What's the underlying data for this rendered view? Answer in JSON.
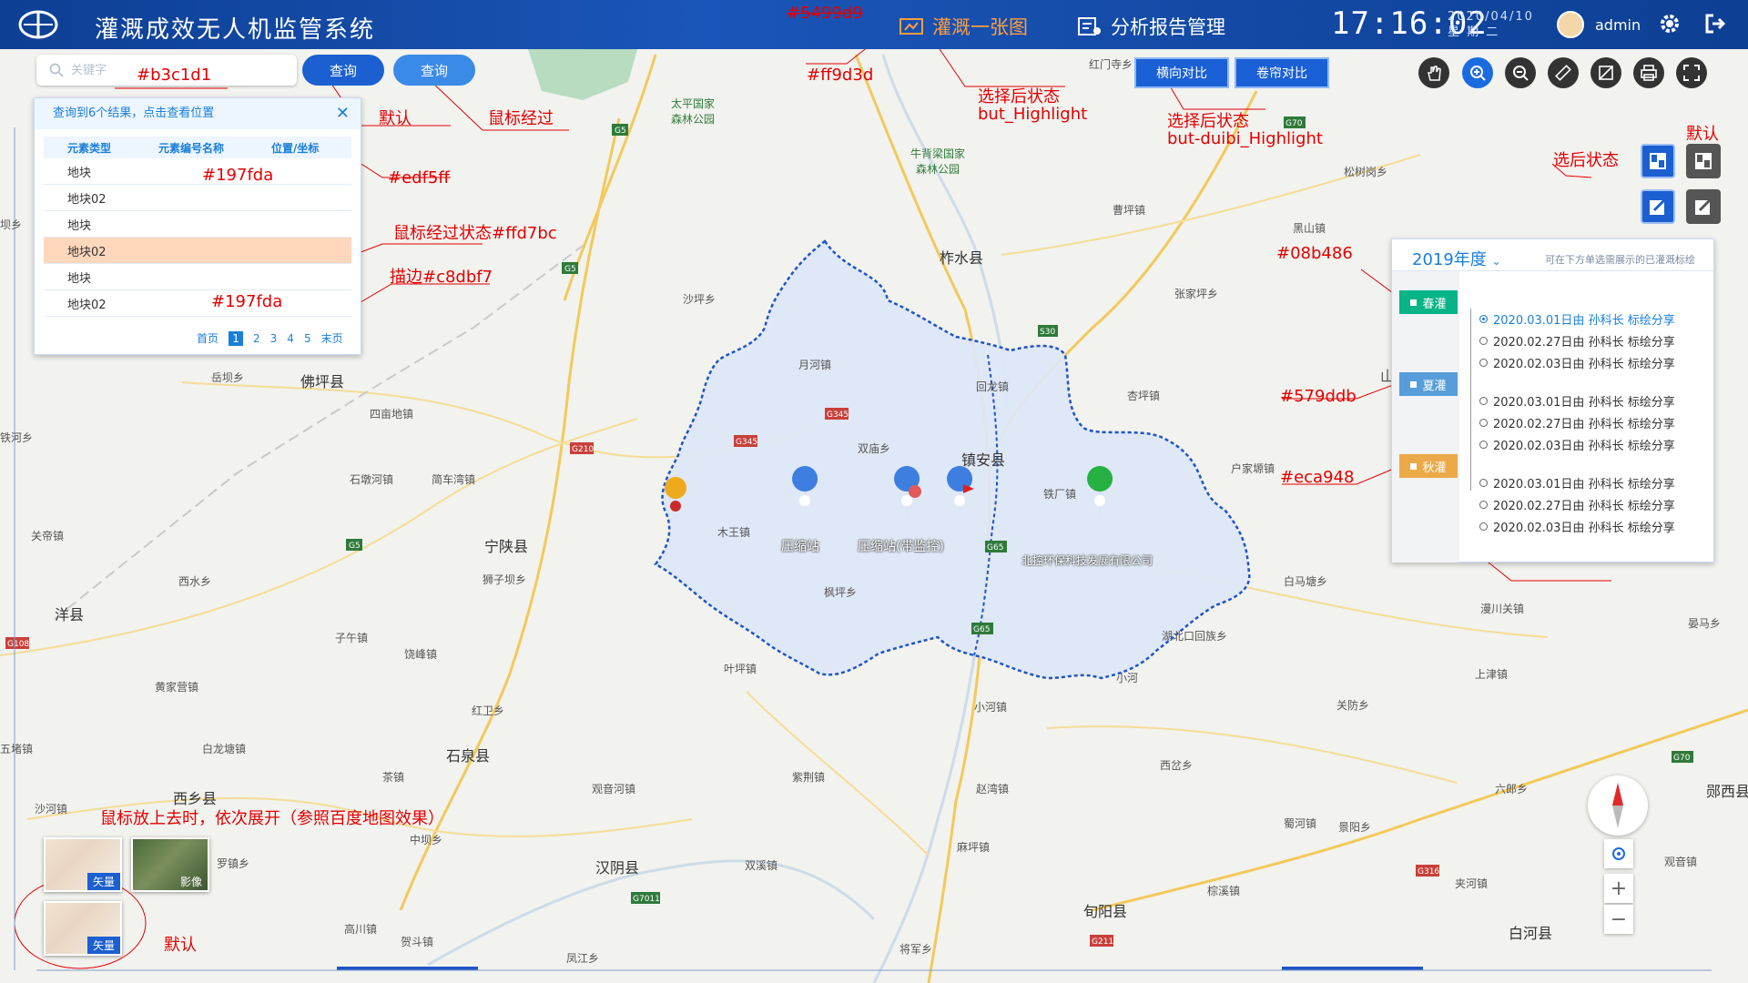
{
  "header": {
    "title": "灌溉成效无人机监管系统",
    "nav_items": [
      {
        "label": "灌溉一张图",
        "active": true
      },
      {
        "label": "分析报告管理",
        "active": false
      }
    ],
    "time": "17:16:02",
    "date_line1": "2020/04/10",
    "date_line2": "星 期 二",
    "username": "admin",
    "active_color": "#ff9d3d"
  },
  "search": {
    "placeholder": "关键字",
    "query_button_default": "查询",
    "query_button_hover": "查询"
  },
  "results": {
    "header": "查询到6个结果，点击查看位置",
    "columns": [
      "元素类型",
      "元素编号名称",
      "位置/坐标"
    ],
    "rows": [
      "地块",
      "地块02",
      "地块",
      "地块02",
      "地块",
      "地块02"
    ],
    "hover_row_index": 3,
    "pager": {
      "first": "首页",
      "pages": [
        "1",
        "2",
        "3",
        "4",
        "5"
      ],
      "current": "1",
      "last": "末页"
    }
  },
  "compare": {
    "horizontal": "横向对比",
    "curtain": "卷帘对比"
  },
  "tools": [
    "hand-icon",
    "zoom-in-icon",
    "zoom-out-icon",
    "ruler-icon",
    "area-measure-icon",
    "print-icon",
    "fullscreen-icon"
  ],
  "season_panel": {
    "year": "2019年度",
    "tip": "可在下方单选需展示的已灌溉标绘",
    "seasons": [
      {
        "name": "春灌",
        "color": "#08b486",
        "items": [
          "2020.03.01日由 孙科长 标绘分享",
          "2020.02.27日由 孙科长 标绘分享",
          "2020.02.03日由 孙科长 标绘分享"
        ]
      },
      {
        "name": "夏灌",
        "color": "#579ddb",
        "items": [
          "2020.03.01日由 孙科长 标绘分享",
          "2020.02.27日由 孙科长 标绘分享",
          "2020.02.03日由 孙科长 标绘分享"
        ]
      },
      {
        "name": "秋灌",
        "color": "#eca948",
        "items": [
          "2020.03.01日由 孙科长 标绘分享",
          "2020.02.27日由 孙科长 标绘分享",
          "2020.02.03日由 孙科长 标绘分享"
        ]
      }
    ]
  },
  "annotations": {
    "a_b3c1d1": "#b3c1d1",
    "a_default": "默认",
    "a_hover": "鼠标经过",
    "a_197fda_1": "#197fda",
    "a_edf5ff": "#edf5ff",
    "a_hover_state": "鼠标经过状态#ffd7bc",
    "a_stroke": "描边#c8dbf7",
    "a_197fda_2": "#197fda",
    "a_5499d9": "#5499d9",
    "a_ff9d3d": "#ff9d3d",
    "a_selected": "选择后状态",
    "a_but_highlight": "but_Highlight",
    "a_selected2": "选择后状态",
    "a_duibi": "but-duibi_Highlight",
    "a_default_r": "默认",
    "a_selected_r": "选后状态",
    "a_08b486": "#08b486",
    "a_579ddb": "#579ddb",
    "a_eca948": "#eca948",
    "a_basemap_tip": "鼠标放上去时，依次展开（参照百度地图效果）",
    "a_default_bl": "默认"
  },
  "basemaps": {
    "vector": "矢量",
    "image": "影像",
    "vector_default": "矢量"
  },
  "map": {
    "pois": [
      {
        "label": "压缩站",
        "color": "#3d7ee0"
      },
      {
        "label": "压缩站(带监控)",
        "color": "#3d7ee0"
      },
      {
        "label": "北控环保科技发展有限公司",
        "color": "#27b043"
      }
    ],
    "towns": {
      "county1": "镇安县",
      "county2": "柞水县",
      "county3": "宁陕县",
      "county4": "石泉县",
      "county5": "汉阴县",
      "county6": "旬阳县",
      "county7": "佛坪县",
      "county8": "洋县",
      "county9": "西乡县",
      "county10": "郧西县",
      "county11": "白河县",
      "park1": "太平国家\n森林公园",
      "park2": "牛背梁国家\n森林公园",
      "t1": "月河镇",
      "t2": "回龙镇",
      "t3": "双庙乡",
      "t4": "木王镇",
      "t5": "枫坪乡",
      "t6": "铁厂镇",
      "t7": "杏坪镇",
      "t8": "张家坪乡",
      "t9": "沙坪乡",
      "t10": "曹坪镇",
      "t11": "黑山镇",
      "t12": "松树岗乡",
      "t13": "红门寺乡",
      "t14": "户家塬镇",
      "t15": "白马塘乡",
      "t16": "湖北口回族乡",
      "t17": "小河",
      "t18": "小河镇",
      "t19": "叶坪镇",
      "t20": "红卫乡",
      "t21": "饶峰镇",
      "t22": "子午镇",
      "t23": "狮子坝乡",
      "t24": "四亩地镇",
      "t25": "石墩河镇",
      "t26": "简车湾镇",
      "t27": "岳坝乡",
      "t28": "关帝镇",
      "t29": "西水乡",
      "t30": "黄家营镇",
      "t31": "白龙塘镇",
      "t32": "茶镇",
      "t33": "紫荆镇",
      "t34": "观音河镇",
      "t35": "赵湾镇",
      "t36": "西岔乡",
      "t37": "关防乡",
      "t38": "上津镇",
      "t39": "漫川关镇",
      "t40": "夹河镇",
      "t41": "六郎乡",
      "t42": "晏马乡",
      "t43": "蜀河镇",
      "t44": "景阳乡",
      "t45": "观音镇",
      "t46": "麻坪镇",
      "t47": "双溪镇",
      "t48": "棕溪镇",
      "t49": "将军乡",
      "t50": "凤江乡",
      "t51": "罗镇乡",
      "t52": "中坝乡",
      "t53": "高川镇",
      "t54": "贺斗镇",
      "t55": "沙河镇",
      "t56": "五堵镇",
      "t57": "铁河乡",
      "t58": "坝乡",
      "t59": "山"
    },
    "roads": [
      "G5",
      "G5",
      "G5",
      "S30",
      "G70",
      "G345",
      "G345",
      "G210",
      "G65",
      "G65",
      "G108",
      "G7011",
      "G211",
      "G316",
      "G70"
    ]
  }
}
